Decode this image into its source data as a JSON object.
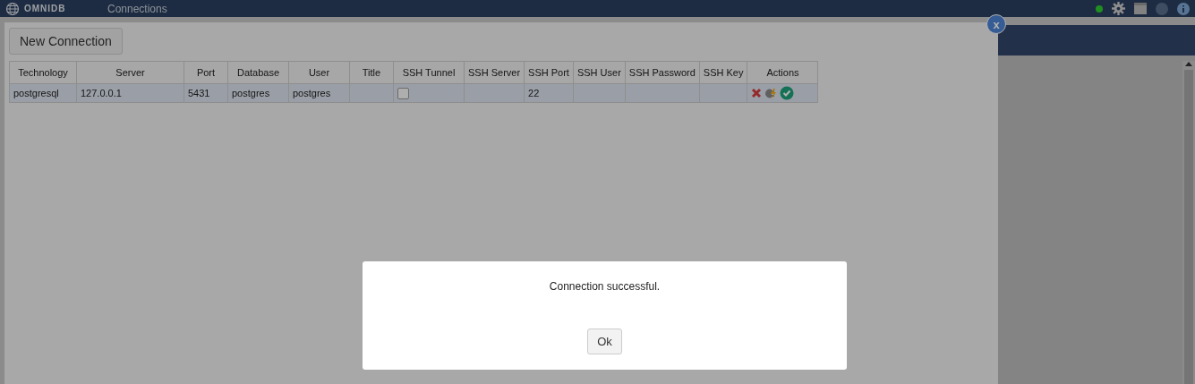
{
  "topbar": {
    "logo": "OMNIDB",
    "nav": "Connections"
  },
  "window": {
    "close": "x",
    "new_button": "New Connection",
    "table": {
      "columns": [
        "Technology",
        "Server",
        "Port",
        "Database",
        "User",
        "Title",
        "SSH Tunnel",
        "SSH Server",
        "SSH Port",
        "SSH User",
        "SSH Password",
        "SSH Key",
        "Actions"
      ],
      "rows": [
        {
          "selected": true,
          "cells": [
            {
              "kind": "text",
              "text": "postgresql"
            },
            {
              "kind": "text",
              "text": "127.0.0.1"
            },
            {
              "kind": "text",
              "text": "5431"
            },
            {
              "kind": "text",
              "text": "postgres"
            },
            {
              "kind": "text",
              "text": "postgres"
            },
            {
              "kind": "empty"
            },
            {
              "kind": "checkbox",
              "checked": false
            },
            {
              "kind": "empty"
            },
            {
              "kind": "text",
              "text": "22"
            },
            {
              "kind": "empty"
            },
            {
              "kind": "empty"
            },
            {
              "kind": "empty"
            },
            {
              "kind": "actions"
            }
          ]
        }
      ]
    }
  },
  "dialog": {
    "message": "Connection successful.",
    "button": "Ok"
  }
}
